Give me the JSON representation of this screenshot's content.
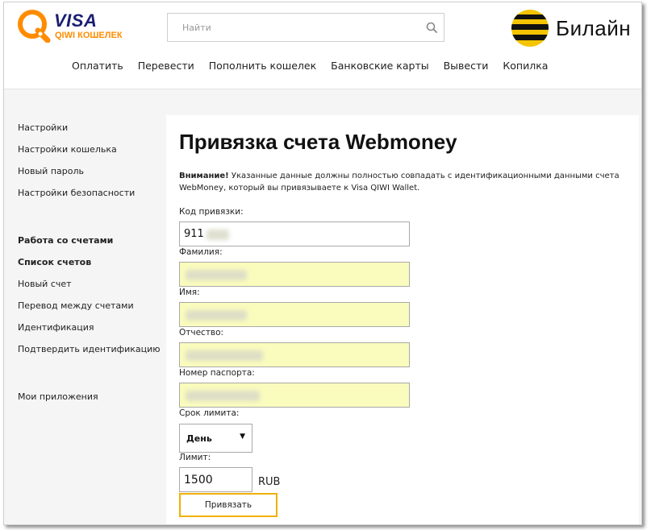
{
  "header": {
    "logo": {
      "line1": "VISA",
      "line2": "QIWI КОШЕЛЕК"
    },
    "search": {
      "placeholder": "Найти"
    },
    "partner": {
      "name": "Билайн"
    },
    "nav": [
      "Оплатить",
      "Перевести",
      "Пополнить кошелек",
      "Банковские карты",
      "Вывести",
      "Копилка"
    ]
  },
  "sidebar": {
    "settings": [
      "Настройки",
      "Настройки кошелька",
      "Новый пароль",
      "Настройки безопасности"
    ],
    "accounts_header": "Работа со счетами",
    "accounts_active": "Список счетов",
    "accounts": [
      "Новый счет",
      "Перевод между счетами",
      "Идентификация",
      "Подтвердить идентификацию"
    ],
    "apps": "Мои приложения"
  },
  "main": {
    "title": "Привязка счета Webmoney",
    "notice_bold": "Внимание!",
    "notice_text": " Указанные данные должны полностью совпадать с идентификационными данными счета WebMoney, который вы привязываете к Visa QIWI Wallet.",
    "fields": {
      "code_label": "Код привязки:",
      "code_value": "911",
      "lastname_label": "Фамилия:",
      "firstname_label": "Имя:",
      "patronymic_label": "Отчество:",
      "passport_label": "Номер паспорта:",
      "period_label": "Срок лимита:",
      "period_value": "День",
      "limit_label": "Лимит:",
      "limit_value": "1500",
      "currency": "RUB"
    },
    "submit": "Привязать"
  },
  "colors": {
    "autofill": "#fafcbd",
    "button_border": "#f0b000",
    "qiwi_orange": "#ff8c00",
    "visa_blue": "#1a1f71",
    "beeline_yellow": "#f5c400"
  },
  "icons": [
    "qiwi-logo-icon",
    "search-icon",
    "beeline-logo-icon",
    "dropdown-arrow-icon"
  ]
}
